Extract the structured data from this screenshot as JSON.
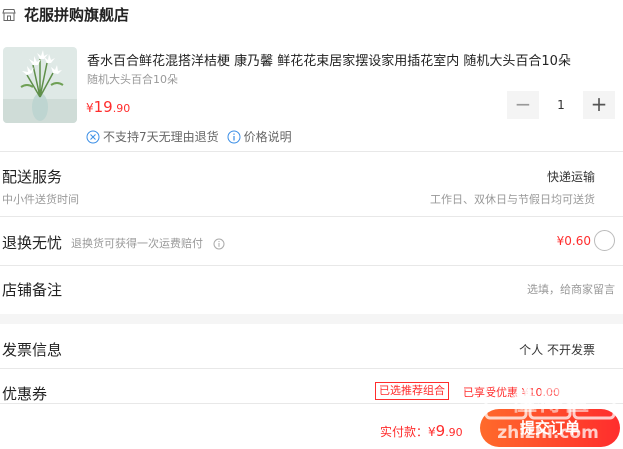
{
  "store": {
    "name": "花服拼购旗舰店",
    "icon": "store-icon"
  },
  "product": {
    "title": "香水百合鲜花混搭洋桔梗 康乃馨 鲜花花束居家摆设家用插花室内 随机大头百合10朵",
    "spec": "随机大头百合10朵",
    "price_currency": "¥",
    "price_int": "19",
    "price_dec": ".90",
    "quantity": "1",
    "minus_label": "−",
    "plus_label": "+",
    "policy_no_return": "不支持7天无理由退货",
    "policy_price_note": "价格说明"
  },
  "delivery": {
    "label": "配送服务",
    "method": "快递运输",
    "sub_left": "中小件送货时间",
    "sub_right": "工作日、双休日与节假日均可送货"
  },
  "return_worry": {
    "label": "退换无忧",
    "desc": "退换货可获得一次运费赔付",
    "price": "¥0.60"
  },
  "remark": {
    "label": "店铺备注",
    "placeholder": "选填，给商家留言"
  },
  "invoice": {
    "label": "发票信息",
    "value": "个人 不开发票"
  },
  "coupon": {
    "label": "优惠券",
    "tag": "已选推荐组合",
    "amount": "已享受优惠 ¥10.00"
  },
  "footer": {
    "total_label": "实付款：¥",
    "total_int": "9",
    "total_dec": ".90",
    "submit_label": "提交订单"
  },
  "watermark": {
    "line1": "值得值",
    "line2": "zhizhi.com"
  },
  "colors": {
    "accent": "#ff2d2d",
    "accent_gradient_start": "#ff6a2b",
    "muted": "#999999"
  }
}
